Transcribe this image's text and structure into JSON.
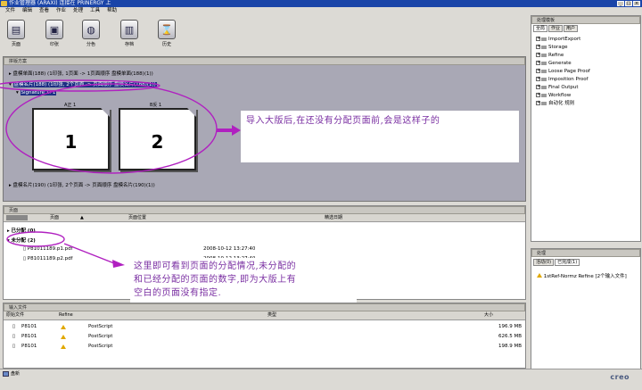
{
  "window": {
    "title": "作业管理器 (ARAXI) 连接在 PRINERGY 上",
    "controls": [
      "_",
      "□",
      "×"
    ]
  },
  "menu": [
    "文件",
    "编辑",
    "查看",
    "作业",
    "处理",
    "工具",
    "帮助"
  ],
  "toolbar": [
    {
      "label": "页面",
      "icon": "pages-icon",
      "glyph": "▤"
    },
    {
      "label": "印张",
      "icon": "sheet-icon",
      "glyph": "▣"
    },
    {
      "label": "分色",
      "icon": "separations-icon",
      "glyph": "◍"
    },
    {
      "label": "存档",
      "icon": "archive-icon",
      "glyph": "▥"
    },
    {
      "label": "历史",
      "icon": "history-icon",
      "glyph": "⌛"
    }
  ],
  "plan": {
    "header": "拼版方案",
    "row1": "盘模单面(188) (1印张, 1页面 -> 1页面顺序 盘模单面(188)(1))",
    "row2": "盘模名片(188) (1印张, 2个页面 -> 页面顺序 盘模名片(188)(1))",
    "signature": "Signature 1: 1",
    "front_label": "A正 1",
    "back_label": "B反 1",
    "page1": "1",
    "page2": "2",
    "row3": "盘模名片(190) (1印张, 2个页面 -> 页面顺序 盘模名片(190)(1))"
  },
  "note1": "导入大版后,在还没有分配页面前,会是这样子的",
  "pages_panel": {
    "header": "页面",
    "col_page": "页面",
    "col_position": "页面位置",
    "col_date": "精选日期",
    "assigned": "已分配 (0)",
    "unassigned": "未分配 (2)",
    "files": [
      {
        "name": "P81011189.p1.pdf",
        "date": "2008-10-12 13:27:40"
      },
      {
        "name": "P81011189.p2.pdf",
        "date": "2008-10-12 13:27:40"
      }
    ]
  },
  "note2": [
    "这里即可看到页面的分配情况,未分配的",
    "和已经分配的页面的数字,即为大版上有",
    "空白的页面没有指定."
  ],
  "input_panel": {
    "header": "输入文件",
    "col_orig": "原始文件",
    "col_refine": "Refine",
    "col_type": "类型",
    "col_size": "大小",
    "rows": [
      {
        "name": "P8101",
        "type": "PostScript",
        "size": "196.9 MB"
      },
      {
        "name": "P8101",
        "type": "PostScript",
        "size": "626.5 MB"
      },
      {
        "name": "P8101",
        "type": "PostScript",
        "size": "198.9 MB"
      }
    ]
  },
  "status": {
    "text": "盘新"
  },
  "process_panel": {
    "header": "处理模板",
    "tabs": [
      "全局",
      "作业",
      "用户"
    ],
    "nodes": [
      "ImportExport",
      "Storage",
      "Refine",
      "Generate",
      "Loose Page Proof",
      "Imposition Proof",
      "Final Output",
      "Workflow",
      "自动化 规则"
    ]
  },
  "process_status": {
    "header": "处理",
    "tab_active": "活动(0)",
    "tab_done": "已完成(1)",
    "item": "1stRef-Normz Refine [2个输入文件]"
  },
  "brand": {
    "logo": "creo"
  },
  "colors": {
    "titlebar": "#1a44a8",
    "annotation": "#b020c0",
    "highlight": "#1c2f84"
  }
}
